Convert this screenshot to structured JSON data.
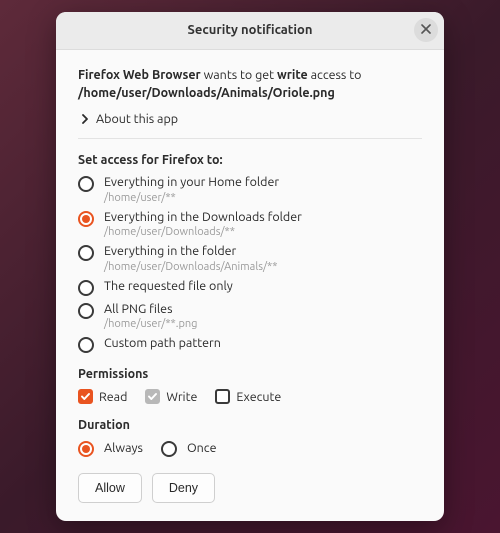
{
  "titlebar": {
    "title": "Security notification"
  },
  "request": {
    "app_name": "Firefox Web Browser",
    "mid1": " wants to get ",
    "access_type": "write",
    "mid2": " access to ",
    "path": "/home/user/Downloads/Animals/Oriole.png"
  },
  "about": {
    "label": "About this app"
  },
  "access_section": {
    "heading": "Set access for Firefox to:",
    "options": [
      {
        "label": "Everything in your Home folder",
        "sub": "/home/user/**",
        "selected": false
      },
      {
        "label": "Everything in the Downloads folder",
        "sub": "/home/user/Downloads/**",
        "selected": true
      },
      {
        "label": "Everything in the folder",
        "sub": "/home/user/Downloads/Animals/**",
        "selected": false
      },
      {
        "label": "The requested file only",
        "sub": "",
        "selected": false
      },
      {
        "label": "All PNG files",
        "sub": "/home/user/**.png",
        "selected": false
      },
      {
        "label": "Custom path pattern",
        "sub": "",
        "selected": false
      }
    ]
  },
  "permissions": {
    "heading": "Permissions",
    "items": [
      {
        "label": "Read",
        "state": "checked"
      },
      {
        "label": "Write",
        "state": "disabled"
      },
      {
        "label": "Execute",
        "state": "unchecked"
      }
    ]
  },
  "duration": {
    "heading": "Duration",
    "options": [
      {
        "label": "Always",
        "selected": true
      },
      {
        "label": "Once",
        "selected": false
      }
    ]
  },
  "buttons": {
    "allow": "Allow",
    "deny": "Deny"
  }
}
